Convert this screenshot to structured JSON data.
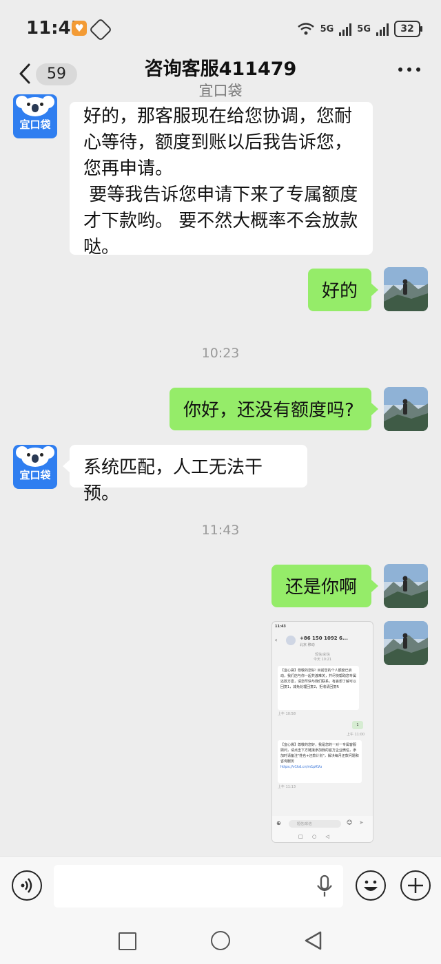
{
  "status_bar": {
    "time": "11:45",
    "network_1": "5G",
    "network_2": "5G",
    "battery": "32"
  },
  "header": {
    "unread_count": "59",
    "title": "咨询客服411479",
    "subtitle": "宜口袋"
  },
  "avatars": {
    "agent_label": "宜口袋"
  },
  "messages": [
    {
      "side": "left",
      "lines": [
        "好的，那客服现在给您协调，您耐",
        "心等待，额度到账以后我告诉您，",
        "您再申请。",
        " 要等我告诉您申请下来了专属额度",
        "才下款哟。 要不然大概率不会放款",
        "哒。"
      ]
    },
    {
      "side": "right",
      "text": "好的"
    },
    {
      "type": "timestamp",
      "text": "10:23"
    },
    {
      "side": "right",
      "text": "你好，还没有额度吗?"
    },
    {
      "side": "left",
      "text": "系统匹配，人工无法干预。"
    },
    {
      "type": "timestamp",
      "text": "11:43"
    },
    {
      "side": "right",
      "text": "还是你啊"
    }
  ],
  "shared_screenshot": {
    "time": "11:43",
    "contact": "+86 150 1092 6...",
    "contact_sub": "北京 移动",
    "header_note": "短信/彩信",
    "header_note2": "今天 10:21",
    "sms_1": "【宜心袋】尊敬的您好! 目前您的个人额度已启动，我们店与你一起共渡难关，并尽快帮助您专属还款方案，请您尽快与我们联系，有妄想了解可以回复1，减免处理回复2，拒收请回复R",
    "sms_1_time": "上午 10:58",
    "reply": "1",
    "reply_time": "上午 11:00",
    "sms_2": "【宜心袋】尊敬的您好，我是您的一对一专属客服顾问，请点击下方链接添加我的官方企业微信，添加时请备注\"姓名+还款计划\"，解决每月还款问题和咨询服务",
    "sms_2_link": "https://v1kd.cn/m1pKVu",
    "sms_2_time": "上午 11:13",
    "input_placeholder": "短信/彩信"
  },
  "colors": {
    "green_bubble": "#95ec69",
    "agent_avatar": "#2f7ef0",
    "background": "#ededed"
  }
}
